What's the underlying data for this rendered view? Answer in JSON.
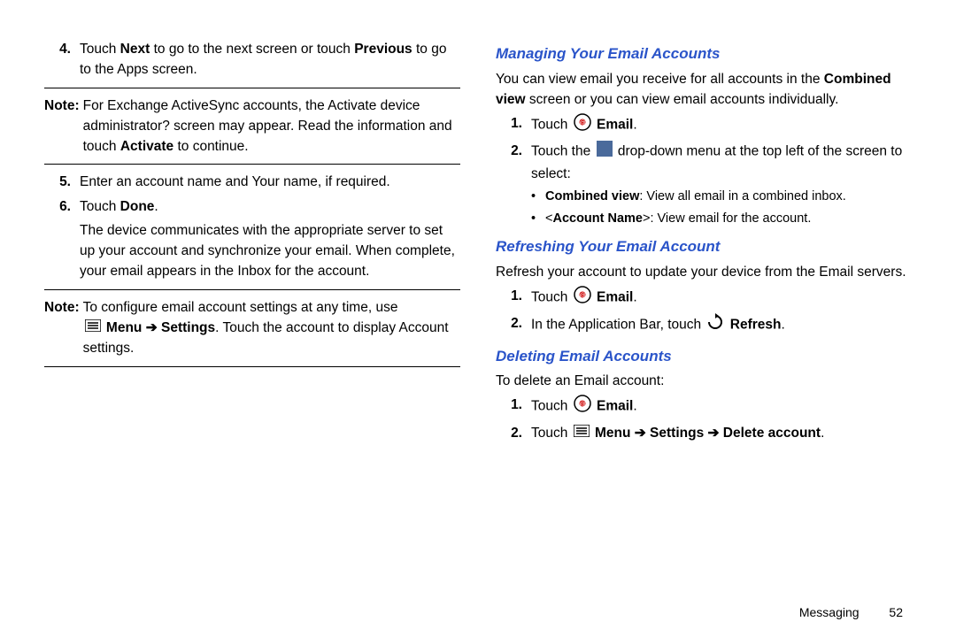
{
  "left": {
    "step4": {
      "num": "4.",
      "text_a": "Touch ",
      "bold1": "Next",
      "text_b": " to go to the next screen or touch ",
      "bold2": "Previous",
      "text_c": " to go to the Apps screen."
    },
    "note1": {
      "label": "Note:",
      "text_a": " For Exchange ActiveSync accounts, the Activate device administrator? screen may appear. Read the information and touch ",
      "bold1": "Activate",
      "text_b": " to continue."
    },
    "step5": {
      "num": "5.",
      "text": "Enter an account name and Your name, if required."
    },
    "step6": {
      "num": "6.",
      "text_a": "Touch ",
      "bold1": "Done",
      "text_b": ".",
      "cont": "The device communicates with the appropriate server to set up your account and synchronize your email. When complete, your email appears in the Inbox for the account."
    },
    "note2": {
      "label": "Note:",
      "text_a": " To configure email account settings at any time, use",
      "cont_bold": "Menu ➔ Settings",
      "cont_b": ". Touch the account to display Account settings."
    }
  },
  "right": {
    "heading1": "Managing Your Email Accounts",
    "para1_a": "You can view email you receive for all accounts in the ",
    "para1_bold": "Combined view",
    "para1_b": " screen or you can view email accounts individually.",
    "s1": {
      "num": "1.",
      "a": "Touch ",
      "bold": "Email",
      "b": "."
    },
    "s2": {
      "num": "2.",
      "a": "Touch the ",
      "b": " drop-down menu at the top left of the screen to select:"
    },
    "bul1": {
      "bold": "Combined view",
      "rest": ": View all email in a combined inbox."
    },
    "bul2": {
      "a": "<",
      "bold": "Account Name",
      "b": ">: View email for the account."
    },
    "heading2": "Refreshing Your Email Account",
    "para2": "Refresh your account to update your device from the Email servers.",
    "r1": {
      "num": "1.",
      "a": "Touch ",
      "bold": "Email",
      "b": "."
    },
    "r2": {
      "num": "2.",
      "a": "In the Application Bar, touch ",
      "bold": "Refresh",
      "b": "."
    },
    "heading3": "Deleting Email Accounts",
    "para3": "To delete an Email account:",
    "d1": {
      "num": "1.",
      "a": "Touch ",
      "bold": "Email",
      "b": "."
    },
    "d2": {
      "num": "2.",
      "a": "Touch ",
      "bold": "Menu ➔ Settings ➔ Delete account",
      "b": "."
    }
  },
  "footer": {
    "section": "Messaging",
    "page": "52"
  }
}
